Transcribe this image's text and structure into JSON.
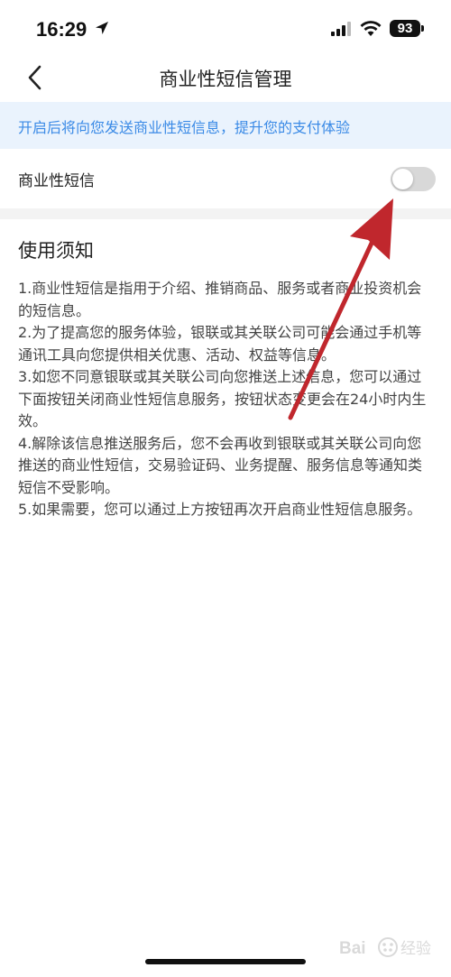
{
  "status_bar": {
    "time": "16:29",
    "battery": "93"
  },
  "nav": {
    "title": "商业性短信管理"
  },
  "banner": {
    "text": "开启后将向您发送商业性短信息，提升您的支付体验"
  },
  "toggle_row": {
    "label": "商业性短信",
    "state": "off"
  },
  "notes": {
    "title": "使用须知",
    "items": [
      "1.商业性短信是指用于介绍、推销商品、服务或者商业投资机会的短信息。",
      "2.为了提高您的服务体验，银联或其关联公司可能会通过手机等通讯工具向您提供相关优惠、活动、权益等信息。",
      "3.如您不同意银联或其关联公司向您推送上述信息，您可以通过下面按钮关闭商业性短信息服务，按钮状态变更会在24小时内生效。",
      "4.解除该信息推送服务后，您不会再收到银联或其关联公司向您推送的商业性短信，交易验证码、业务提醒、服务信息等通知类短信不受影响。",
      "5.如果需要，您可以通过上方按钮再次开启商业性短信息服务。"
    ]
  },
  "colors": {
    "accent": "#3a8ae6",
    "banner_bg": "#eaf3fd",
    "arrow": "#c0272d"
  },
  "icons": {
    "back": "chevron-left-icon",
    "location": "location-arrow-icon",
    "signal": "cellular-signal-icon",
    "wifi": "wifi-icon"
  }
}
